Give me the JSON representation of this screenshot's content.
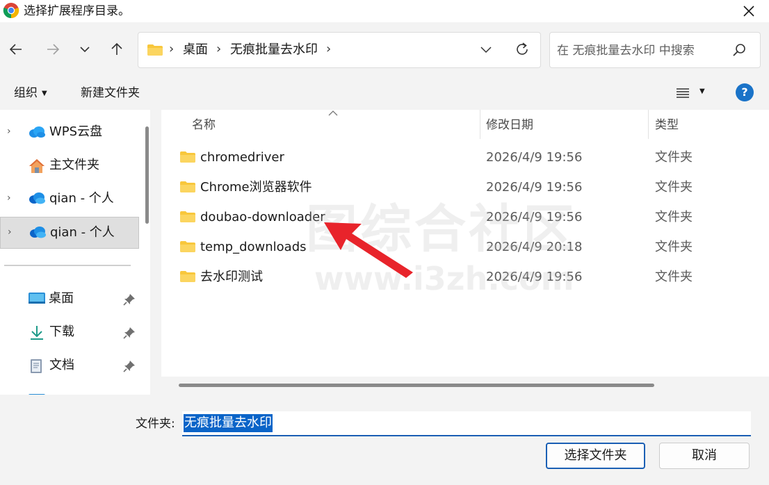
{
  "window": {
    "title": "选择扩展程序目录。",
    "app_icon": "chrome-logo",
    "close_icon": "close-icon"
  },
  "nav": {
    "back_icon": "arrow-left-icon",
    "forward_icon": "arrow-right-icon",
    "recent_icon": "chevron-down-icon",
    "up_icon": "arrow-up-icon"
  },
  "address": {
    "crumbs": [
      "桌面",
      "无痕批量去水印"
    ],
    "dropdown_icon": "chevron-down-icon",
    "refresh_icon": "refresh-icon"
  },
  "search": {
    "placeholder": "在 无痕批量去水印 中搜索",
    "icon": "search-icon"
  },
  "toolbar": {
    "organize": "组织",
    "new_folder": "新建文件夹",
    "view_icon": "list-view-icon",
    "help_label": "?"
  },
  "sidebar": {
    "items": [
      {
        "label": "WPS云盘",
        "icon": "cloud-icon",
        "expandable": true,
        "selected": false
      },
      {
        "label": "主文件夹",
        "icon": "home-icon",
        "expandable": false,
        "selected": false
      },
      {
        "label": "qian - 个人",
        "icon": "onedrive-cloud-icon",
        "expandable": true,
        "selected": false
      },
      {
        "label": "qian - 个人",
        "icon": "onedrive-cloud-icon",
        "expandable": true,
        "selected": true
      }
    ],
    "quick_access": [
      {
        "label": "桌面",
        "icon": "desktop-icon",
        "pinned": true
      },
      {
        "label": "下载",
        "icon": "download-icon",
        "pinned": true
      },
      {
        "label": "文档",
        "icon": "document-icon",
        "pinned": true
      }
    ]
  },
  "filelist": {
    "columns": [
      "名称",
      "修改日期",
      "类型"
    ],
    "rows": [
      {
        "name": "chromedriver",
        "date": "2026/4/9 19:56",
        "type": "文件夹"
      },
      {
        "name": "Chrome浏览器软件",
        "date": "2026/4/9 19:56",
        "type": "文件夹"
      },
      {
        "name": "doubao-downloader",
        "date": "2026/4/9 19:56",
        "type": "文件夹"
      },
      {
        "name": "temp_downloads",
        "date": "2026/4/9 20:18",
        "type": "文件夹"
      },
      {
        "name": "去水印测试",
        "date": "2026/4/9 19:56",
        "type": "文件夹"
      }
    ]
  },
  "watermark": {
    "line1": "图综合社区",
    "line2": "www.i3zh.com"
  },
  "footer": {
    "folder_label": "文件夹:",
    "folder_value": "无痕批量去水印",
    "select_button": "选择文件夹",
    "cancel_button": "取消"
  },
  "colors": {
    "accent": "#1a5fb4",
    "selection": "#0a64c8",
    "folder": "#f8c73c",
    "arrow": "#e8242b"
  }
}
